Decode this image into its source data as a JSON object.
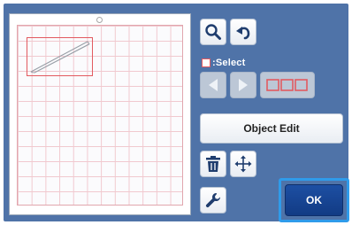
{
  "toolbar": {
    "zoom_icon": "magnifier-icon",
    "undo_icon": "undo-arrow-icon"
  },
  "selection": {
    "label": ":Select",
    "prev_icon": "triangle-left-icon",
    "next_icon": "triangle-right-icon",
    "select_all_icon": "three-boxes-icon"
  },
  "actions": {
    "object_edit_label": "Object Edit",
    "delete_icon": "trash-icon",
    "move_icon": "move-arrows-icon",
    "settings_icon": "wrench-icon",
    "ok_label": "OK"
  },
  "colors": {
    "panel_background": "#4f73a8",
    "selection_outline": "#e25a60",
    "ok_button": "#1d4fa3",
    "ok_highlight": "#2f9bea"
  }
}
